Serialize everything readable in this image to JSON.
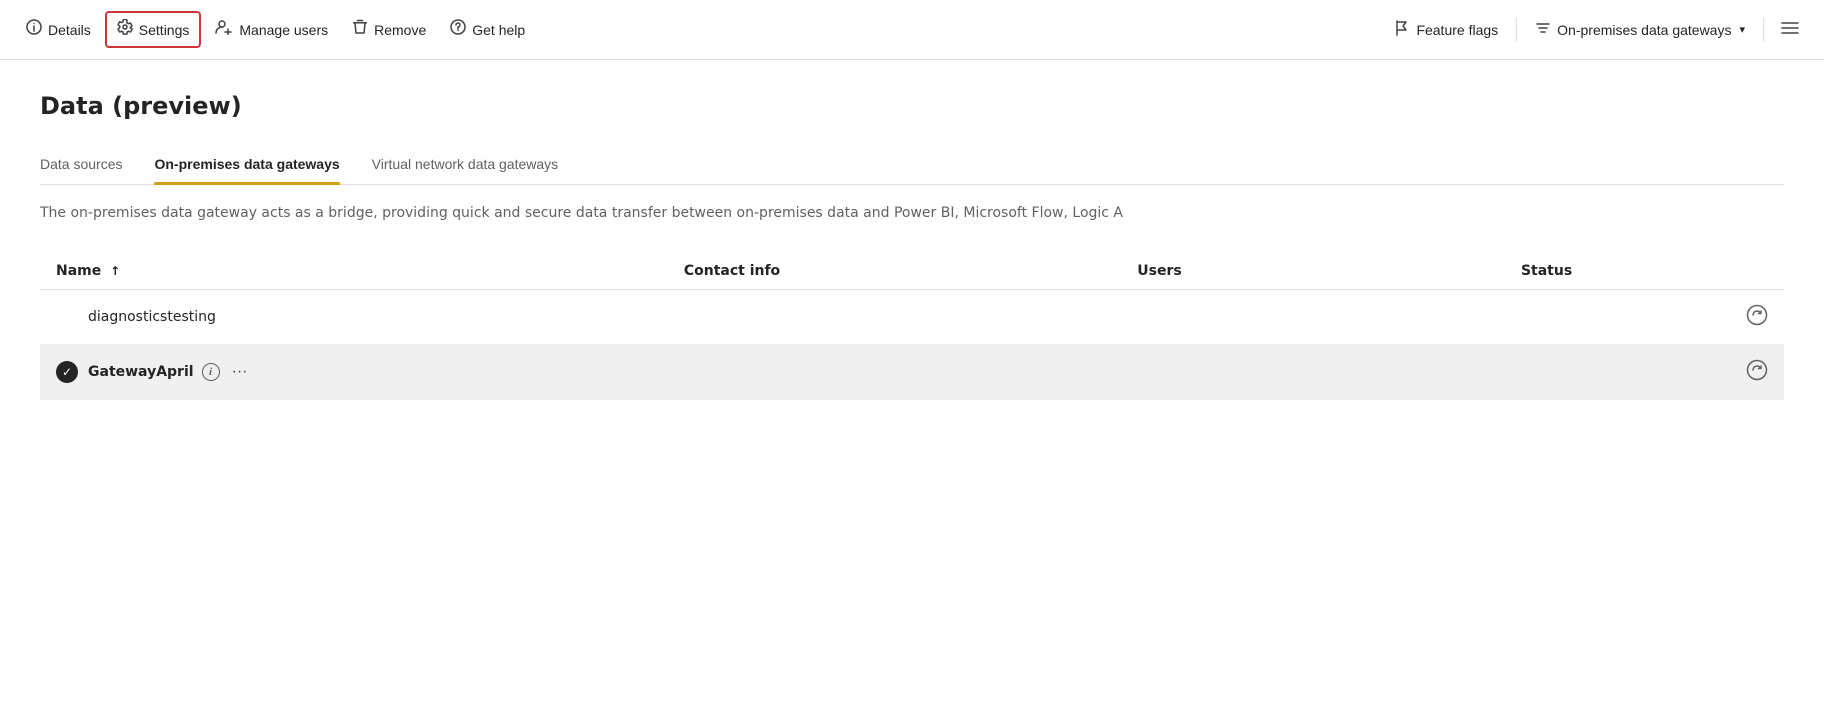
{
  "toolbar": {
    "details_label": "Details",
    "settings_label": "Settings",
    "manage_users_label": "Manage users",
    "remove_label": "Remove",
    "get_help_label": "Get help",
    "feature_flags_label": "Feature flags",
    "on_premises_label": "On-premises data gateways",
    "filter_icon_title": "Filter"
  },
  "page": {
    "title": "Data (preview)"
  },
  "tabs": [
    {
      "id": "data-sources",
      "label": "Data sources",
      "active": false
    },
    {
      "id": "on-premises",
      "label": "On-premises data gateways",
      "active": true
    },
    {
      "id": "virtual-network",
      "label": "Virtual network data gateways",
      "active": false
    }
  ],
  "description": "The on-premises data gateway acts as a bridge, providing quick and secure data transfer between on-premises data and Power BI, Microsoft Flow, Logic A",
  "table": {
    "columns": [
      {
        "id": "name",
        "label": "Name",
        "sort": "asc"
      },
      {
        "id": "contact",
        "label": "Contact info"
      },
      {
        "id": "users",
        "label": "Users"
      },
      {
        "id": "status",
        "label": "Status"
      }
    ],
    "rows": [
      {
        "id": "row1",
        "selected": false,
        "name": "diagnosticstesting",
        "contact": "",
        "users": "",
        "status": "refresh"
      },
      {
        "id": "row2",
        "selected": true,
        "name": "GatewayApril",
        "contact": "",
        "users": "",
        "status": "refresh"
      }
    ]
  }
}
